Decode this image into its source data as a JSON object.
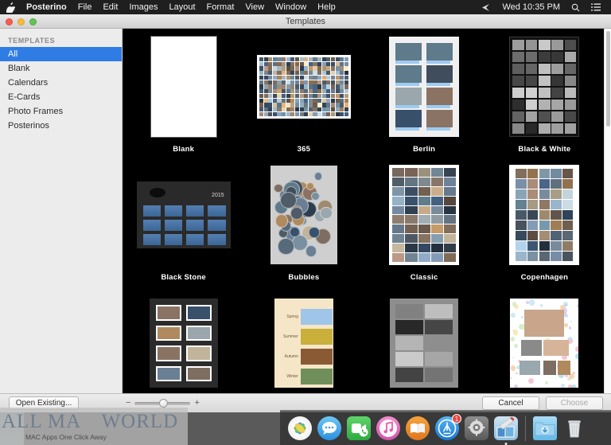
{
  "menubar": {
    "apple_icon": "apple-logo-icon",
    "items": [
      {
        "label": "Posterino",
        "bold": true
      },
      {
        "label": "File",
        "bold": false
      },
      {
        "label": "Edit",
        "bold": false
      },
      {
        "label": "Images",
        "bold": false
      },
      {
        "label": "Layout",
        "bold": false
      },
      {
        "label": "Format",
        "bold": false
      },
      {
        "label": "View",
        "bold": false
      },
      {
        "label": "Window",
        "bold": false
      },
      {
        "label": "Help",
        "bold": false
      }
    ],
    "status": {
      "bluetooth_icon": "bluetooth-icon",
      "clock": "Wed 10:35 PM",
      "search_icon": "search-icon",
      "control_center_icon": "list-icon"
    }
  },
  "window": {
    "title": "Templates",
    "traffic_lights": [
      "close",
      "minimize",
      "zoom"
    ]
  },
  "sidebar": {
    "section_title": "TEMPLATES",
    "items": [
      {
        "label": "All",
        "selected": true
      },
      {
        "label": "Blank",
        "selected": false
      },
      {
        "label": "Calendars",
        "selected": false
      },
      {
        "label": "E-Cards",
        "selected": false
      },
      {
        "label": "Photo Frames",
        "selected": false
      },
      {
        "label": "Posterinos",
        "selected": false
      }
    ]
  },
  "templates": [
    {
      "label": "Blank",
      "kind": "blank"
    },
    {
      "label": "365",
      "kind": "collage-landscape"
    },
    {
      "label": "Berlin",
      "kind": "captioned-photos"
    },
    {
      "label": "Black & White",
      "kind": "bw-grid"
    },
    {
      "label": "Black Stone",
      "kind": "calendar",
      "year": "2015"
    },
    {
      "label": "Bubbles",
      "kind": "circles"
    },
    {
      "label": "Classic",
      "kind": "dense-grid"
    },
    {
      "label": "Copenhagen",
      "kind": "spaced-grid"
    },
    {
      "label": "",
      "kind": "dark-frames"
    },
    {
      "label": "",
      "kind": "seasons",
      "seasons": [
        "Spring",
        "Summer",
        "Autumn",
        "Winter"
      ]
    },
    {
      "label": "",
      "kind": "gray-frames"
    },
    {
      "label": "",
      "kind": "confetti"
    }
  ],
  "bottombar": {
    "open_existing_label": "Open Existing...",
    "zoom_minus": "−",
    "zoom_plus": "+",
    "zoom_value": 50,
    "cancel_label": "Cancel",
    "choose_label": "Choose",
    "choose_disabled": true
  },
  "watermark": {
    "title_left": "ALL MA",
    "title_right": "WORLD",
    "apple_glyph": "",
    "tagline": "MAC Apps One Click Away"
  },
  "dock": {
    "items": [
      {
        "name": "photos",
        "icon": "photos-icon",
        "running": false
      },
      {
        "name": "messages",
        "icon": "messages-icon",
        "running": false
      },
      {
        "name": "facetime",
        "icon": "facetime-icon",
        "running": false
      },
      {
        "name": "itunes",
        "icon": "itunes-icon",
        "running": false
      },
      {
        "name": "ibooks",
        "icon": "ibooks-icon",
        "running": false
      },
      {
        "name": "app-store",
        "icon": "app-store-icon",
        "running": false,
        "badge": "1"
      },
      {
        "name": "system-preferences",
        "icon": "gear-icon",
        "running": false
      },
      {
        "name": "posterino",
        "icon": "posterino-icon",
        "running": true
      },
      {
        "name": "downloads",
        "icon": "folder-icon",
        "running": false
      },
      {
        "name": "trash",
        "icon": "trash-icon",
        "running": false
      }
    ]
  }
}
